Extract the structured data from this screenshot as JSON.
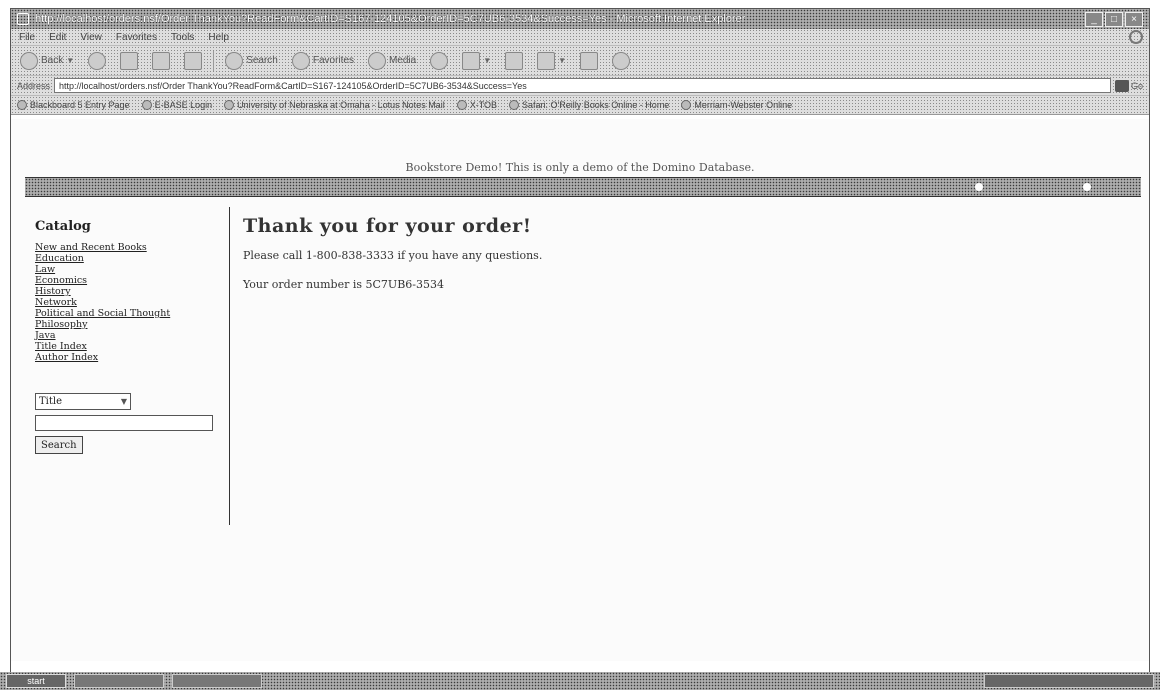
{
  "window": {
    "title": "http://localhost/orders.nsf/Order ThankYou?ReadForm&CartID=S167-124105&OrderID=5C7UB6-3534&Success=Yes - Microsoft Internet Explorer",
    "min_label": "_",
    "max_label": "□",
    "close_label": "×"
  },
  "menubar": {
    "items": [
      "File",
      "Edit",
      "View",
      "Favorites",
      "Tools",
      "Help"
    ]
  },
  "toolbar": {
    "back_label": "Back",
    "search_label": "Search",
    "favorites_label": "Favorites",
    "media_label": "Media"
  },
  "addressbar": {
    "label": "Address",
    "url": "http://localhost/orders.nsf/Order ThankYou?ReadForm&CartID=S167-124105&OrderID=5C7UB6-3534&Success=Yes",
    "go_label": "Go"
  },
  "linksbar": {
    "links": [
      "Blackboard 5 Entry Page",
      "E-BASE Login",
      "University of Nebraska at Omaha - Lotus Notes Mail",
      "X-TOB",
      "Safari: O'Reilly Books Online - Home",
      "Merriam-Webster Online"
    ]
  },
  "page": {
    "demo_notice": "Bookstore Demo! This is only a demo of the Domino Database.",
    "sidebar": {
      "heading": "Catalog",
      "categories": [
        "New and Recent Books",
        "Education",
        "Law",
        "Economics",
        "History",
        "Network",
        "Political and Social Thought",
        "Philosophy",
        "Java",
        "Title Index",
        "Author Index"
      ],
      "search_field_selected": "Title",
      "search_button": "Search"
    },
    "main": {
      "heading": "Thank you for your order!",
      "call_text": "Please call 1-800-838-3333 if you have any questions.",
      "order_text": "Your order number is 5C7UB6-3534"
    }
  },
  "taskbar": {
    "start_label": "start"
  }
}
